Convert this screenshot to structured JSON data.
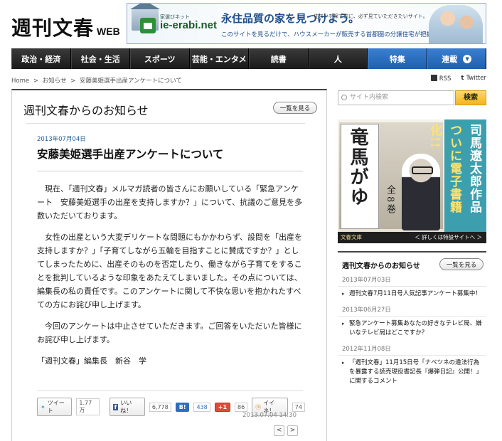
{
  "header": {
    "logo_main": "週刊文春",
    "logo_web": "WEB"
  },
  "banner": {
    "brand_small": "家選びネット",
    "brand": "ie-erabi.net",
    "headline": "永住品質の家を見つけよう。",
    "sub1": "住まいを探す前に、必ず見ていただきたいサイト。",
    "sub2": "このサイトを見るだけで、ハウスメーカーが販売する首都圏の分譲住宅が把握できる！"
  },
  "nav": {
    "items": [
      {
        "label": "政治・経済"
      },
      {
        "label": "社会・生活"
      },
      {
        "label": "スポーツ"
      },
      {
        "label": "芸能・エンタメ"
      },
      {
        "label": "読書"
      },
      {
        "label": "人"
      },
      {
        "label": "特集"
      },
      {
        "label": "連載"
      }
    ]
  },
  "breadcrumb": {
    "home": "Home",
    "sep": ">",
    "notice": "お知らせ",
    "current": "安藤美姫選手出産アンケートについて"
  },
  "social_top": {
    "rss": "RSS",
    "twitter": "Twitter"
  },
  "main": {
    "title": "週刊文春からのお知らせ",
    "list_button": "一覧を見る",
    "date": "2013年07月04日",
    "headline": "安藤美姫選手出産アンケートについて",
    "paragraphs": [
      "現在、「週刊文春」メルマガ読者の皆さんにお願いしている「緊急アンケート　安藤美姫選手の出産を支持しますか？」について、抗議のご意見を多数いただいております。",
      "女性の出産という大変デリケートな問題にもかかわらず、設問を「出産を支持しますか？」「子育てしながら五輪を目指すことに賛成ですか？」としてしまったために、出産そのものを否定したり、働きながら子育てをすることを批判しているような印象をあたえてしまいました。その点については、編集長の私の責任です。このアンケートに関して不快な思いを抱かれたすべての方にお詫び申し上げます。",
      "今回のアンケートは中止させていただきます。ご回答をいただいた皆様にお詫び申し上げます。"
    ],
    "signature": "「週刊文春」編集長　新谷　学",
    "share": {
      "tweet_label": "ツイート",
      "tweet_count": "1.77万",
      "like_label": "いいね！",
      "like_count": "6,778",
      "hatena_label": "B!",
      "hatena_count": "438",
      "gplus_label": "+1",
      "gplus_count": "86",
      "iine_label": "イイネ！",
      "iine_count": "74"
    },
    "timestamp": "2013.07.04 14:30",
    "pager_prev": "<",
    "pager_next": ">"
  },
  "sidebar": {
    "search_placeholder": "サイト内検索",
    "search_button": "検索",
    "ad": {
      "title": "竜馬がゆく",
      "volumes": "全8巻",
      "right_line1": "司馬遼太郎作品",
      "right_line2": "ついに電子書籍化!!",
      "publisher": "文春文庫",
      "foot": "＜ 詳しくは特設サイトへ ＞"
    },
    "news": {
      "title": "週刊文春からのお知らせ",
      "list_button": "一覧を見る",
      "items": [
        {
          "date": "2013年07月03日",
          "text": "週刊文春7月11日号人気記事アンケート募集中！"
        },
        {
          "date": "2013年06月27日",
          "text": "緊急アンケート募集あなたの好きなテレビ局、嫌いなテレビ局はどこですか？"
        },
        {
          "date": "2012年11月08日",
          "text": "「週刊文春」11月15日号「ナベツネの違法行為を暴露する読売現役書記長『爆弾日記』公開！」に関するコメント"
        }
      ]
    }
  },
  "colors": {
    "nav_dark": "#222222",
    "nav_blue": "#2a6fc0",
    "date_blue": "#1d5c9a",
    "search_button": "#f4b51d",
    "ad_teal": "#3d9fae"
  }
}
